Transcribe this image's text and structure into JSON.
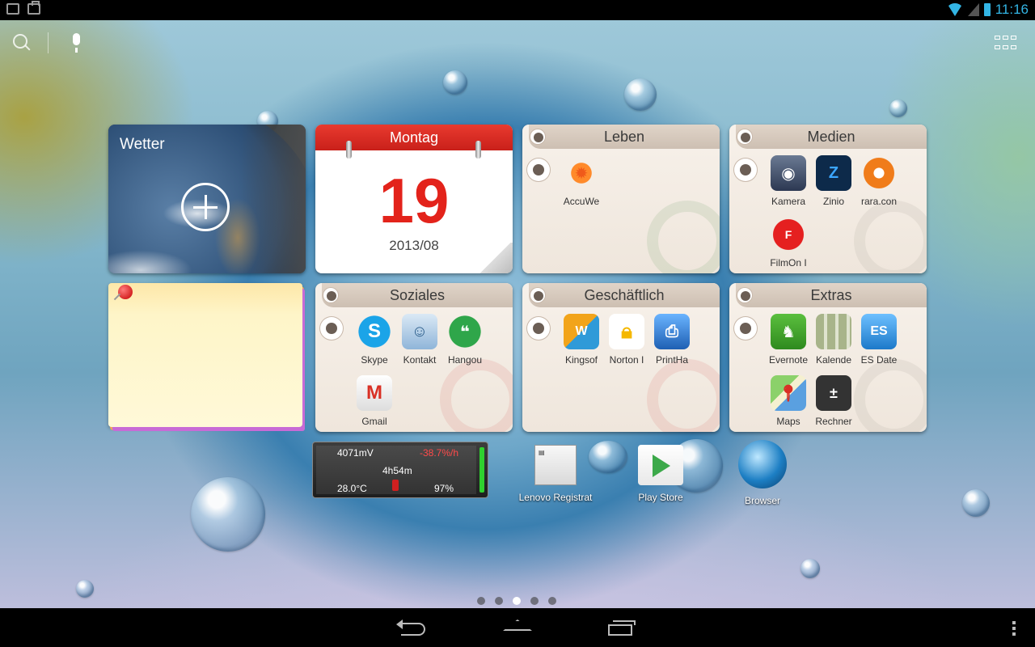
{
  "status_bar": {
    "time": "11:16"
  },
  "weather": {
    "title": "Wetter"
  },
  "calendar": {
    "weekday": "Montag",
    "day": "19",
    "month": "2013/08"
  },
  "folders": [
    {
      "title": "Leben",
      "apps": [
        {
          "label": "AccuWe",
          "icon": "accuweather-icon",
          "color": "#f05a1a"
        }
      ]
    },
    {
      "title": "Medien",
      "apps": [
        {
          "label": "Kamera",
          "icon": "camera-icon",
          "color": "#3b4a66"
        },
        {
          "label": "Zinio",
          "icon": "zinio-icon",
          "color": "#0d2a4a"
        },
        {
          "label": "rara.con",
          "icon": "rara-icon",
          "color": "#f07c1a"
        },
        {
          "label": "FilmOn I",
          "icon": "filmon-icon",
          "color": "#d81b1b"
        }
      ]
    },
    {
      "title": "Soziales",
      "apps": [
        {
          "label": "Skype",
          "icon": "skype-icon",
          "color": "#1ba4e8"
        },
        {
          "label": "Kontakt",
          "icon": "contacts-icon",
          "color": "#4a90c8"
        },
        {
          "label": "Hangou",
          "icon": "hangouts-icon",
          "color": "#2fa64a"
        },
        {
          "label": "Gmail",
          "icon": "gmail-icon",
          "color": "#d93025"
        }
      ]
    },
    {
      "title": "Geschäftlich",
      "apps": [
        {
          "label": "Kingsof",
          "icon": "kingsoft-icon",
          "color": "#f2a41a"
        },
        {
          "label": "Norton I",
          "icon": "norton-icon",
          "color": "#f5b800"
        },
        {
          "label": "PrintHa",
          "icon": "printhand-icon",
          "color": "#2b7fd6"
        }
      ]
    },
    {
      "title": "Extras",
      "apps": [
        {
          "label": "Evernote",
          "icon": "evernote-icon",
          "color": "#3f9b2b"
        },
        {
          "label": "Kalende",
          "icon": "calendar-icon",
          "color": "#7a8a5a"
        },
        {
          "label": "ES Date",
          "icon": "es-file-icon",
          "color": "#2b8ad6"
        },
        {
          "label": "Maps",
          "icon": "maps-icon",
          "color": "#4aa84a"
        },
        {
          "label": "Rechner",
          "icon": "calculator-icon",
          "color": "#333333"
        }
      ]
    }
  ],
  "battery_widget": {
    "voltage": "4071mV",
    "rate": "-38.7%/h",
    "duration": "4h54m",
    "temperature": "28.0°C",
    "level": "97%"
  },
  "dock": [
    {
      "label": "Lenovo Registrat",
      "icon": "lenovo-registration-icon"
    },
    {
      "label": "Play Store",
      "icon": "play-store-icon"
    },
    {
      "label": "Browser",
      "icon": "browser-icon"
    }
  ],
  "page_indicator": {
    "count": 5,
    "active": 3
  }
}
